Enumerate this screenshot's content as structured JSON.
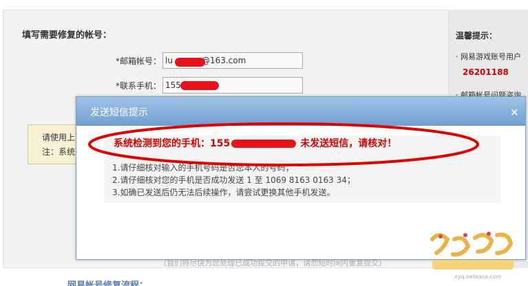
{
  "form": {
    "section_title": "填写需要修复的帐号：",
    "email_label": "*邮箱帐号：",
    "email_prefix": "lu",
    "email_suffix": "@163.com",
    "phone_label": "*联系手机：",
    "phone_prefix": "155"
  },
  "tips": {
    "title": "温馨提示：",
    "item1": "网易游戏账号用户",
    "item1_number": "26201188",
    "item2": "邮箱帐号问题咨询"
  },
  "notice": {
    "line1": "请使用上",
    "line2": "注：系统"
  },
  "modal": {
    "title": "发送短信提示",
    "close": "×",
    "alert_prefix": "系统检测到您的手机：155",
    "alert_suffix": "未发送短信，请核对！",
    "step1": "1.请仔细核对输入的手机号码是否您本人的号码；",
    "step2": "2.请仔细核对您的手机是否成功发送 1 至 1069 8163 0163 34；",
    "step3": "3.如确已发送后仍无法后续操作，请尝试更换其他手机发送。"
  },
  "footer": {
    "faded_note": "(我们将尽快为您处理已成功提交的申请，请勿短时间内重复提交)",
    "link": "网易帐号修复流程："
  },
  "logo": {
    "url_text": "xyq.netease.com"
  },
  "colors": {
    "alert_red": "#d90000",
    "header_blue": "#6f9fd1",
    "redaction_red": "#e8131a"
  }
}
